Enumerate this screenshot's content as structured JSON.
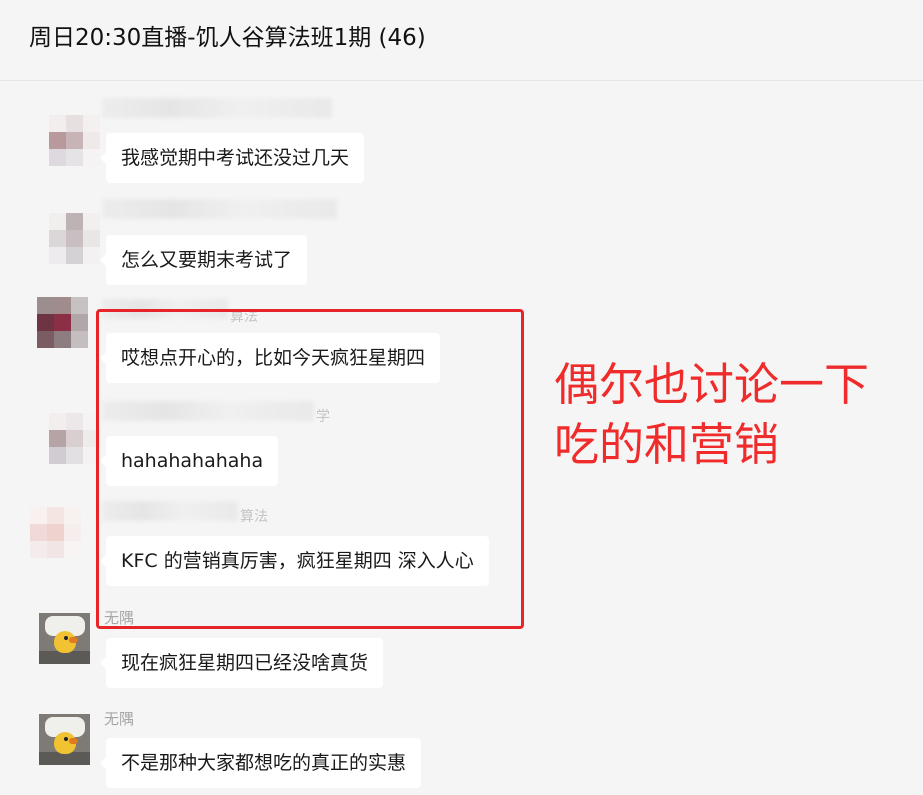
{
  "header": {
    "title": "周日20:30直播-饥人谷算法班1期 (46)"
  },
  "messages": [
    {
      "sender_visible": "",
      "sender_suffix": "",
      "text": "我感觉期中考试还没过几天"
    },
    {
      "sender_visible": "",
      "sender_suffix": "",
      "text": "怎么又要期末考试了"
    },
    {
      "sender_visible": "",
      "sender_suffix": "算法",
      "text": "哎想点开心的，比如今天疯狂星期四"
    },
    {
      "sender_visible": "",
      "sender_suffix": "学",
      "text": "hahahahahaha"
    },
    {
      "sender_visible": "",
      "sender_suffix": "算法",
      "text": "KFC 的营销真厉害，疯狂星期四 深入人心"
    },
    {
      "sender_visible": "无隅",
      "sender_suffix": "",
      "text": "现在疯狂星期四已经没啥真货"
    },
    {
      "sender_visible": "无隅",
      "sender_suffix": "",
      "text": "不是那种大家都想吃的真正的实惠"
    }
  ],
  "annotation": {
    "line1": "偶尔也讨论一下",
    "line2": "吃的和营销",
    "color": "#ef2b2b"
  },
  "colors": {
    "background": "#f5f5f5",
    "bubble": "#ffffff",
    "highlight_border": "#e8242b"
  }
}
